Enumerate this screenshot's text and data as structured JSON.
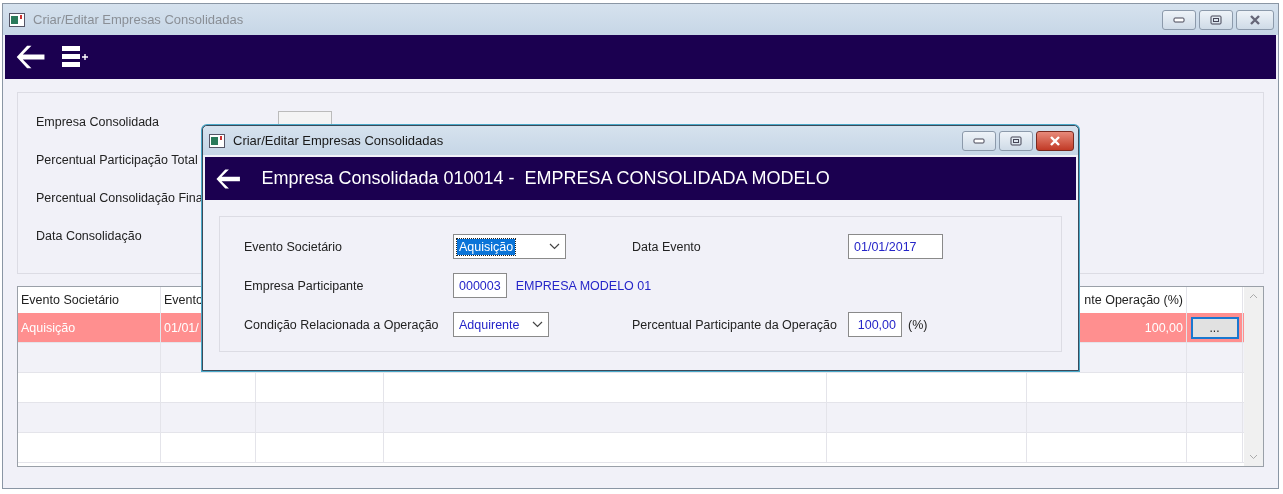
{
  "window": {
    "title": "Criar/Editar Empresas Consolidadas",
    "active": false
  },
  "form": {
    "fields": [
      {
        "label": "Empresa Consolidada",
        "kind": "lookup"
      },
      {
        "label": "Percentual Participação Total"
      },
      {
        "label": "Percentual Consolidação Fina"
      },
      {
        "label": "Data Consolidação"
      }
    ]
  },
  "table": {
    "columns": [
      {
        "kind": "text",
        "label": "Evento Societário"
      },
      {
        "kind": "text",
        "label": "Evento"
      },
      {
        "kind": "blank"
      },
      {
        "kind": "blank"
      },
      {
        "kind": "blank"
      },
      {
        "kind": "numeric",
        "label": "nte Operação (%)"
      },
      {
        "kind": "action"
      }
    ],
    "rows": [
      {
        "selected": true,
        "cells": [
          "Aquisição",
          "01/01/",
          null,
          null,
          null,
          "100,00",
          "..."
        ]
      }
    ]
  },
  "dialog": {
    "title": "Criar/Editar Empresas Consolidadas",
    "active": true,
    "heading": "Empresa Consolidada 010014 -  EMPRESA CONSOLIDADA MODELO",
    "rows": [
      [
        {
          "kind": "select",
          "label": "Evento Societário",
          "value": "Aquisição",
          "focused": true
        },
        {
          "kind": "input",
          "label": "Data Evento",
          "value": "01/01/2017"
        }
      ],
      [
        {
          "kind": "lookup",
          "label": "Empresa Participante",
          "value": "000003",
          "name": "EMPRESA MODELO 01"
        }
      ],
      [
        {
          "kind": "select",
          "label": "Condição Relacionada a Operação",
          "value": "Adquirente",
          "focused": false
        },
        {
          "kind": "number",
          "label": "Percentual Participante da Operação",
          "value": "100,00",
          "unit": "(%)"
        }
      ]
    ]
  }
}
